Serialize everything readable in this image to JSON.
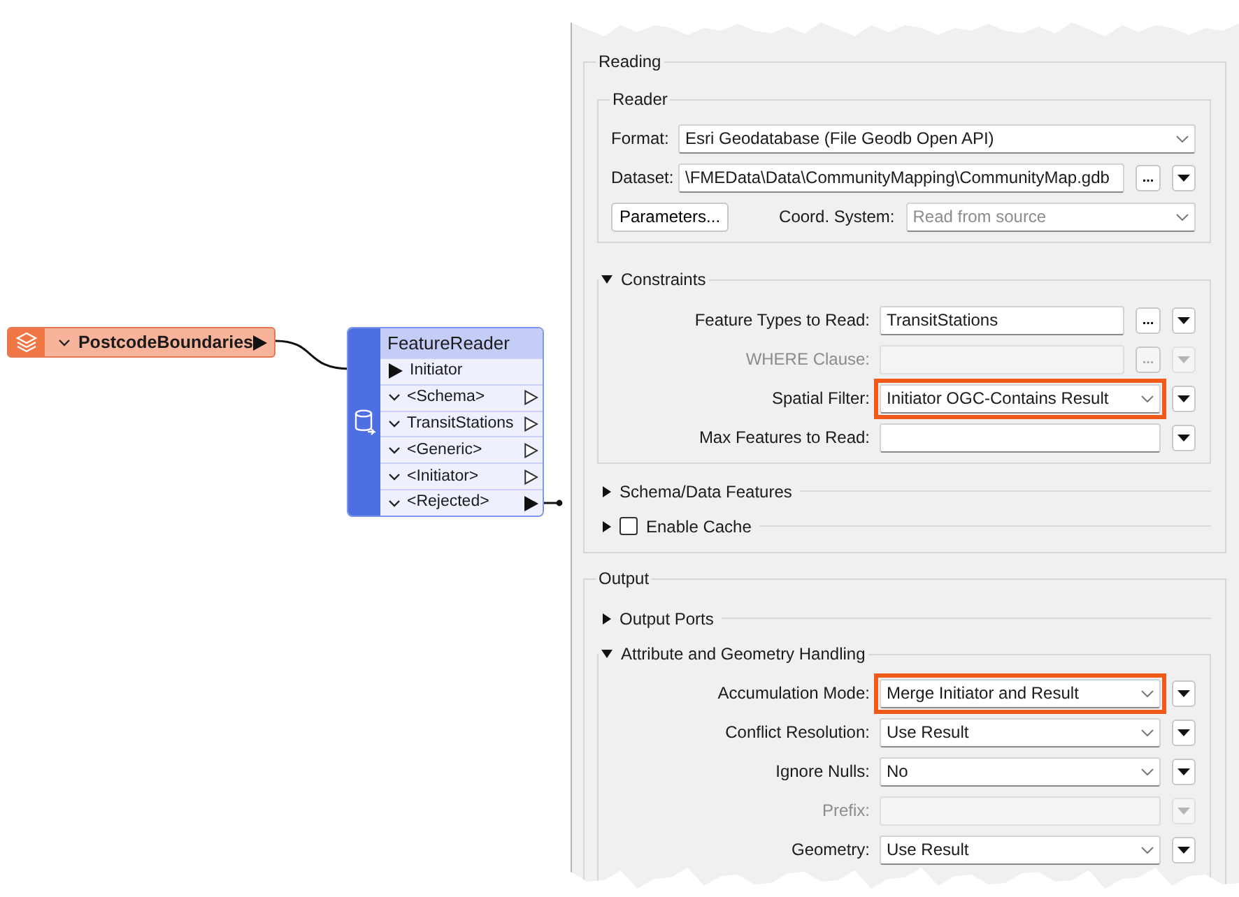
{
  "canvas": {
    "source_node": {
      "name": "PostcodeBoundaries"
    },
    "transformer": {
      "name": "FeatureReader",
      "input_port": "Initiator",
      "output_ports": [
        {
          "label": "<Schema>",
          "connected": false
        },
        {
          "label": "TransitStations",
          "connected": false
        },
        {
          "label": "<Generic>",
          "connected": false
        },
        {
          "label": "<Initiator>",
          "connected": false
        },
        {
          "label": "<Rejected>",
          "connected": true
        }
      ]
    }
  },
  "dialog": {
    "groups": [
      {
        "title": "Reading",
        "reader": {
          "title": "Reader",
          "rows": [
            {
              "kind": "combo",
              "label": "Format:",
              "value": "Esri Geodatabase (File Geodb Open API)"
            },
            {
              "kind": "text",
              "label": "Dataset:",
              "value": "\\FMEData\\Data\\CommunityMapping\\CommunityMap.gdb",
              "browse": "...",
              "menu": true
            },
            {
              "kind": "params",
              "button": "Parameters...",
              "label": "Coord. System:",
              "placeholder": "Read from source"
            }
          ]
        },
        "sections": [
          {
            "kind": "group",
            "title": "Constraints",
            "expanded": true,
            "fields": [
              {
                "kind": "text",
                "label": "Feature Types to Read:",
                "value": "TransitStations",
                "browse": "...",
                "menu": true,
                "disabled": false,
                "highlighted": false
              },
              {
                "kind": "text",
                "label": "WHERE Clause:",
                "browse": "...",
                "menu": true,
                "disabled": true,
                "highlighted": false
              },
              {
                "kind": "combo",
                "label": "Spatial Filter:",
                "value": "Initiator OGC-Contains Result",
                "menu": true,
                "disabled": false,
                "highlighted": true
              },
              {
                "kind": "text",
                "label": "Max Features to Read:",
                "menu": true,
                "disabled": false,
                "highlighted": false
              }
            ]
          },
          {
            "kind": "group",
            "title": "Schema/Data Features",
            "expanded": false
          },
          {
            "kind": "checkbox",
            "title": "Enable Cache",
            "expanded": false,
            "checked": false
          }
        ]
      },
      {
        "title": "Output",
        "sections": [
          {
            "kind": "group",
            "title": "Output Ports",
            "expanded": false
          },
          {
            "kind": "group",
            "title": "Attribute and Geometry Handling",
            "expanded": true,
            "fields": [
              {
                "kind": "combo",
                "label": "Accumulation Mode:",
                "value": "Merge Initiator and Result",
                "menu": true,
                "disabled": false,
                "highlighted": true
              },
              {
                "kind": "combo",
                "label": "Conflict Resolution:",
                "value": "Use Result",
                "menu": true,
                "disabled": false,
                "highlighted": false
              },
              {
                "kind": "combo",
                "label": "Ignore Nulls:",
                "value": "No",
                "menu": true,
                "disabled": false,
                "highlighted": false
              },
              {
                "kind": "text",
                "label": "Prefix:",
                "menu": true,
                "disabled": true,
                "highlighted": false
              },
              {
                "kind": "combo",
                "label": "Geometry:",
                "value": "Use Result",
                "menu": true,
                "disabled": false,
                "highlighted": false
              }
            ]
          }
        ]
      }
    ]
  }
}
